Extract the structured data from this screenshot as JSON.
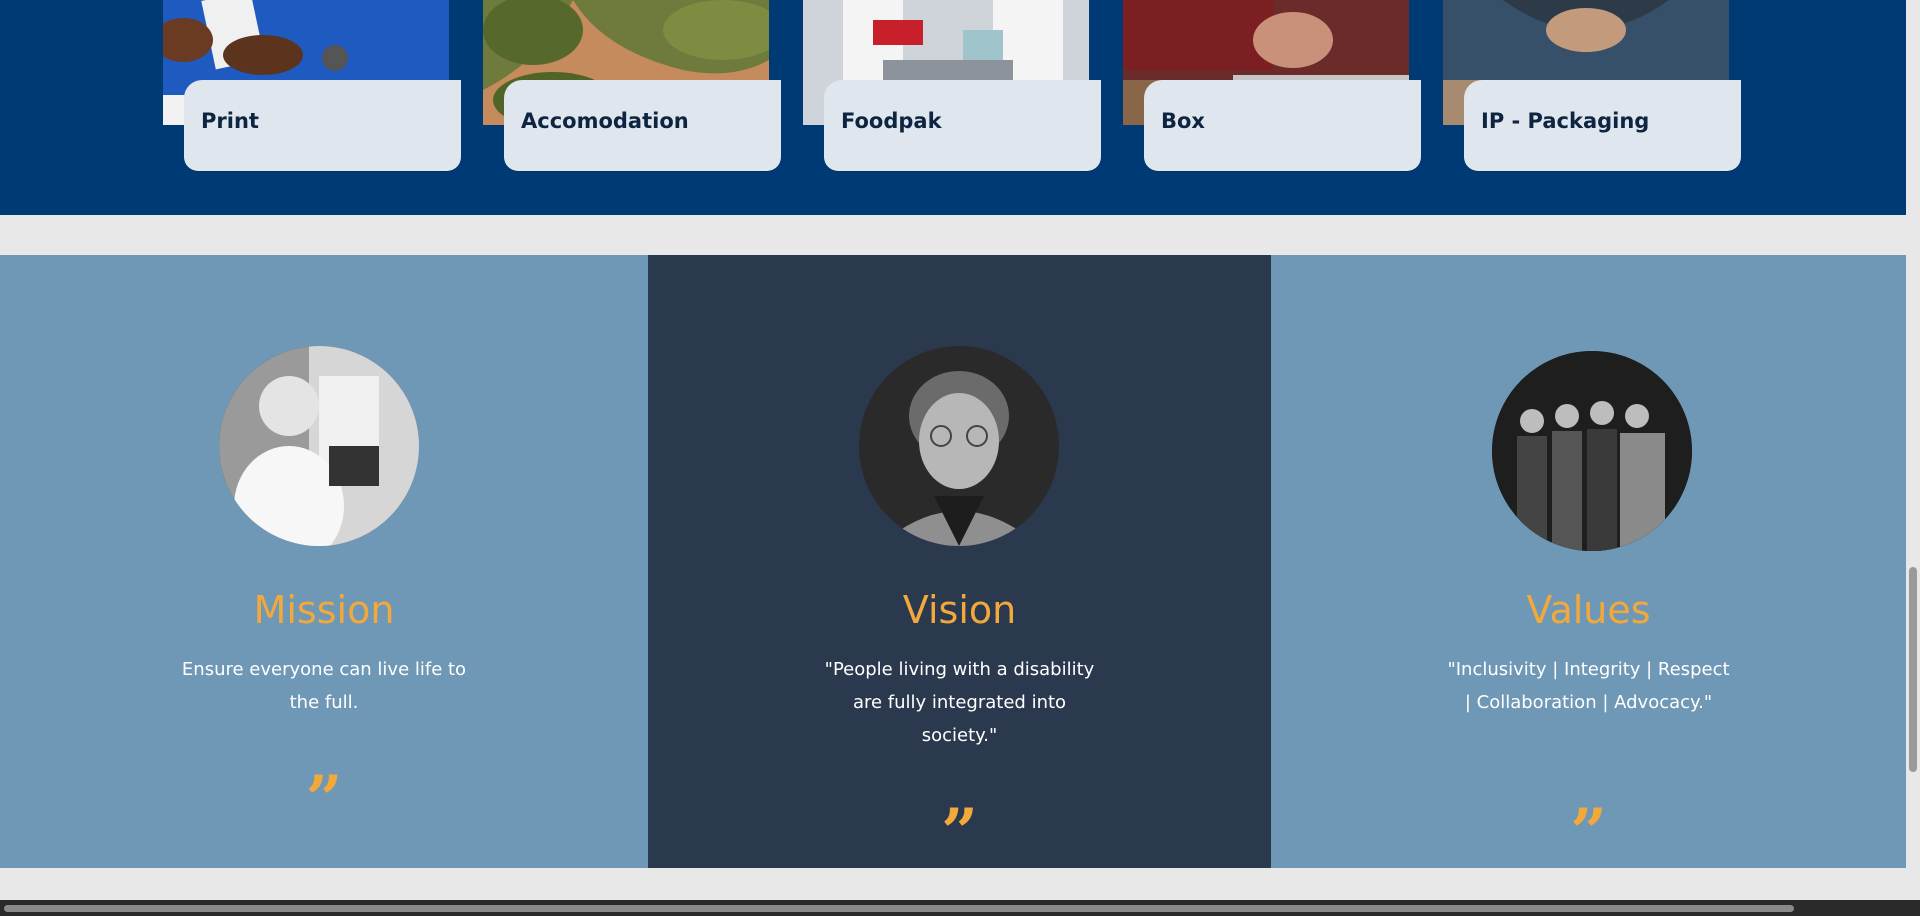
{
  "services": [
    {
      "label": "Print"
    },
    {
      "label": "Accomodation"
    },
    {
      "label": "Foodpak"
    },
    {
      "label": "Box"
    },
    {
      "label": "IP - Packaging"
    }
  ],
  "mission": {
    "title": "Mission",
    "text": "Ensure everyone can live life to the full.",
    "quote_mark": "”"
  },
  "vision": {
    "title": "Vision",
    "text": "\"People living with a disability are fully integrated into society.\"",
    "quote_mark": "”"
  },
  "values": {
    "title": "Values",
    "text": "\"Inclusivity | Integrity | Respect | Collaboration | Advocacy.\"",
    "quote_mark": "”"
  },
  "colors": {
    "top_band": "#003a75",
    "accent_orange": "#f2a83a",
    "light_blue": "#6f98b6",
    "dark_slate": "#2b394f"
  }
}
